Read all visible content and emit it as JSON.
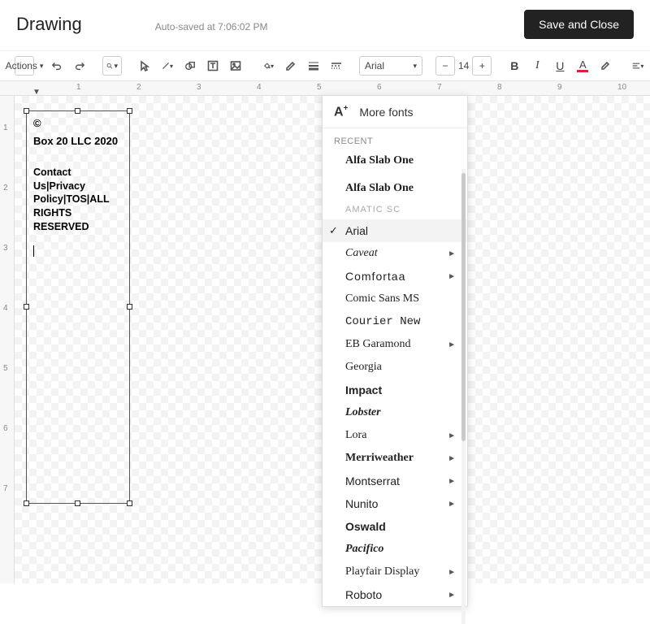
{
  "header": {
    "title": "Drawing",
    "autosave": "Auto-saved at 7:06:02 PM",
    "save_close": "Save and Close"
  },
  "toolbar": {
    "actions_label": "Actions",
    "font_selected": "Arial",
    "font_size": "14"
  },
  "ruler_h": [
    "1",
    "2",
    "3",
    "4",
    "5",
    "6",
    "7",
    "8",
    "9",
    "10"
  ],
  "ruler_v": [
    "1",
    "2",
    "3",
    "4",
    "5",
    "6",
    "7"
  ],
  "textbox": {
    "line1": "©",
    "line2": "Box 20 LLC 2020",
    "line3": "Contact Us|Privacy Policy|TOS|ALL RIGHTS RESERVED"
  },
  "font_menu": {
    "more_fonts": "More fonts",
    "recent_label": "RECENT",
    "recent": [
      "Alfa Slab One"
    ],
    "list": [
      {
        "label": "Alfa Slab One",
        "style": "font-weight:900;font-family:serif;"
      },
      {
        "label": "AMATIC SC",
        "style": "font-family:sans-serif;font-size:11px;letter-spacing:1px;color:#aaa;"
      },
      {
        "label": "Arial",
        "selected": true,
        "style": ""
      },
      {
        "label": "Caveat",
        "style": "font-style:italic;font-family:cursive;",
        "sub": true
      },
      {
        "label": "Comfortaa",
        "style": "font-family:sans-serif;letter-spacing:1px;",
        "sub": true
      },
      {
        "label": "Comic Sans MS",
        "style": "font-family:'Comic Sans MS',cursive;"
      },
      {
        "label": "Courier New",
        "style": "font-family:'Courier New',monospace;"
      },
      {
        "label": "EB Garamond",
        "style": "font-family:Georgia,serif;",
        "sub": true
      },
      {
        "label": "Georgia",
        "style": "font-family:Georgia,serif;"
      },
      {
        "label": "Impact",
        "style": "font-family:Impact,sans-serif;font-weight:bold;"
      },
      {
        "label": "Lobster",
        "style": "font-family:cursive;font-weight:bold;font-style:italic;"
      },
      {
        "label": "Lora",
        "style": "font-family:Georgia,serif;",
        "sub": true
      },
      {
        "label": "Merriweather",
        "style": "font-family:Georgia,serif;font-weight:600;",
        "sub": true
      },
      {
        "label": "Montserrat",
        "style": "font-family:Arial,sans-serif;",
        "sub": true
      },
      {
        "label": "Nunito",
        "style": "font-family:Arial,sans-serif;",
        "sub": true
      },
      {
        "label": "Oswald",
        "style": "font-family:Arial Narrow,sans-serif;font-weight:600;"
      },
      {
        "label": "Pacifico",
        "style": "font-family:cursive;font-style:italic;font-weight:bold;"
      },
      {
        "label": "Playfair Display",
        "style": "font-family:Georgia,serif;",
        "sub": true
      },
      {
        "label": "Roboto",
        "style": "font-family:Arial,sans-serif;",
        "sub": true
      }
    ]
  }
}
